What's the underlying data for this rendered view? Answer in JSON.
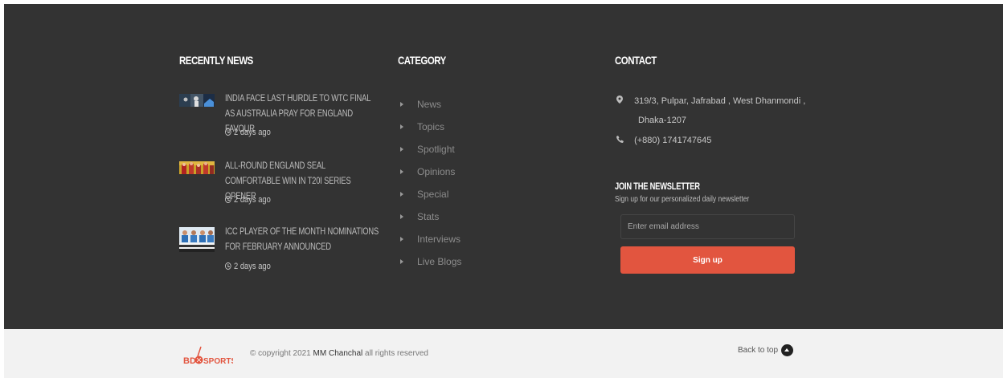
{
  "recent_news": {
    "title": "RECENTLY NEWS",
    "items": [
      {
        "title": "INDIA FACE LAST HURDLE TO WTC FINAL AS AUSTRALIA PRAY FOR ENGLAND FAVOUR",
        "time": "2 days ago"
      },
      {
        "title": "ALL-ROUND ENGLAND SEAL COMFORTABLE WIN IN T20I SERIES OPENER",
        "time": "2 days ago"
      },
      {
        "title": "ICC PLAYER OF THE MONTH NOMINATIONS FOR FEBRUARY ANNOUNCED",
        "time": "2 days ago"
      }
    ]
  },
  "category": {
    "title": "CATEGORY",
    "items": [
      "News",
      "Topics",
      "Spotlight",
      "Opinions",
      "Special",
      "Stats",
      "Interviews",
      "Live Blogs"
    ]
  },
  "contact": {
    "title": "CONTACT",
    "address_line1": "319/3, Pulpar, Jafrabad , West Dhanmondi ,",
    "address_line2": "Dhaka-1207",
    "phone": "(+880) 1741747645"
  },
  "newsletter": {
    "title": "JOIN THE NEWSLETTER",
    "subtitle": "Sign up for our personalized daily newsletter",
    "placeholder": "Enter email address",
    "button": "Sign up"
  },
  "bottom": {
    "logo_text_a": "BD",
    "logo_text_b": "SPORTS",
    "copyright_pre": "© copyright 2021",
    "copyright_name": "MM Chanchal",
    "copyright_post": "all rights reserved",
    "back_to_top": "Back to top"
  },
  "colors": {
    "footer_bg": "#333333",
    "accent": "#e2553f",
    "bottom_bg": "#f2f2f2"
  }
}
